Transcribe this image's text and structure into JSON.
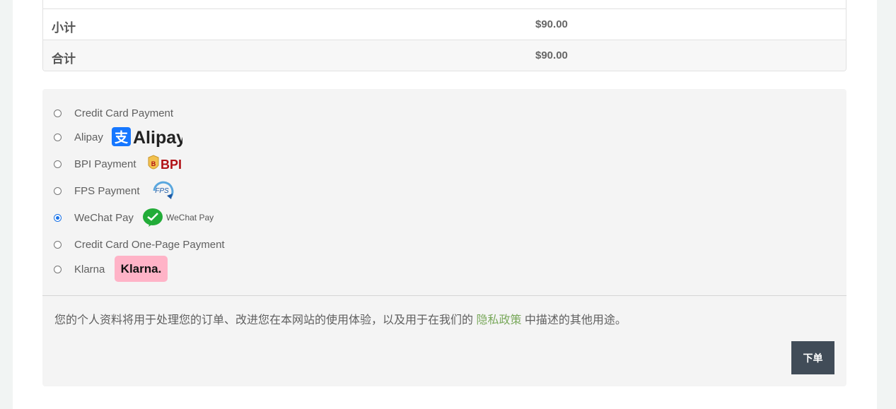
{
  "totals": {
    "subtotal_label": "小计",
    "subtotal_value": "$90.00",
    "total_label": "合计",
    "total_value": "$90.00"
  },
  "payment_methods": [
    {
      "label": "Credit Card Payment",
      "selected": false,
      "logo": null
    },
    {
      "label": "Alipay",
      "selected": false,
      "logo": "alipay-logo",
      "logo_text": "Alipay"
    },
    {
      "label": "BPI Payment",
      "selected": false,
      "logo": "bpi-logo",
      "logo_text": "BPI"
    },
    {
      "label": "FPS Payment",
      "selected": false,
      "logo": "fps-logo",
      "logo_text": "FPS"
    },
    {
      "label": "WeChat Pay",
      "selected": true,
      "logo": "wechat-pay-logo",
      "logo_text": "WeChat Pay"
    },
    {
      "label": "Credit Card One-Page Payment",
      "selected": false,
      "logo": null
    },
    {
      "label": "Klarna",
      "selected": false,
      "logo": "klarna-logo",
      "logo_text": "Klarna."
    }
  ],
  "privacy": {
    "text_before": "您的个人资料将用于处理您的订单、改进您在本网站的使用体验，以及用于在我们的 ",
    "link_text": "隐私政策",
    "text_after": " 中描述的其他用途。"
  },
  "place_order_label": "下单",
  "colors": {
    "accent": "#1a73e8",
    "link": "#7aa95c",
    "button_bg": "#414c58",
    "alipay_blue": "#1677ff",
    "bpi_red": "#b11116",
    "wechat_green": "#22ac38",
    "klarna_pink": "#ffb3c7"
  }
}
